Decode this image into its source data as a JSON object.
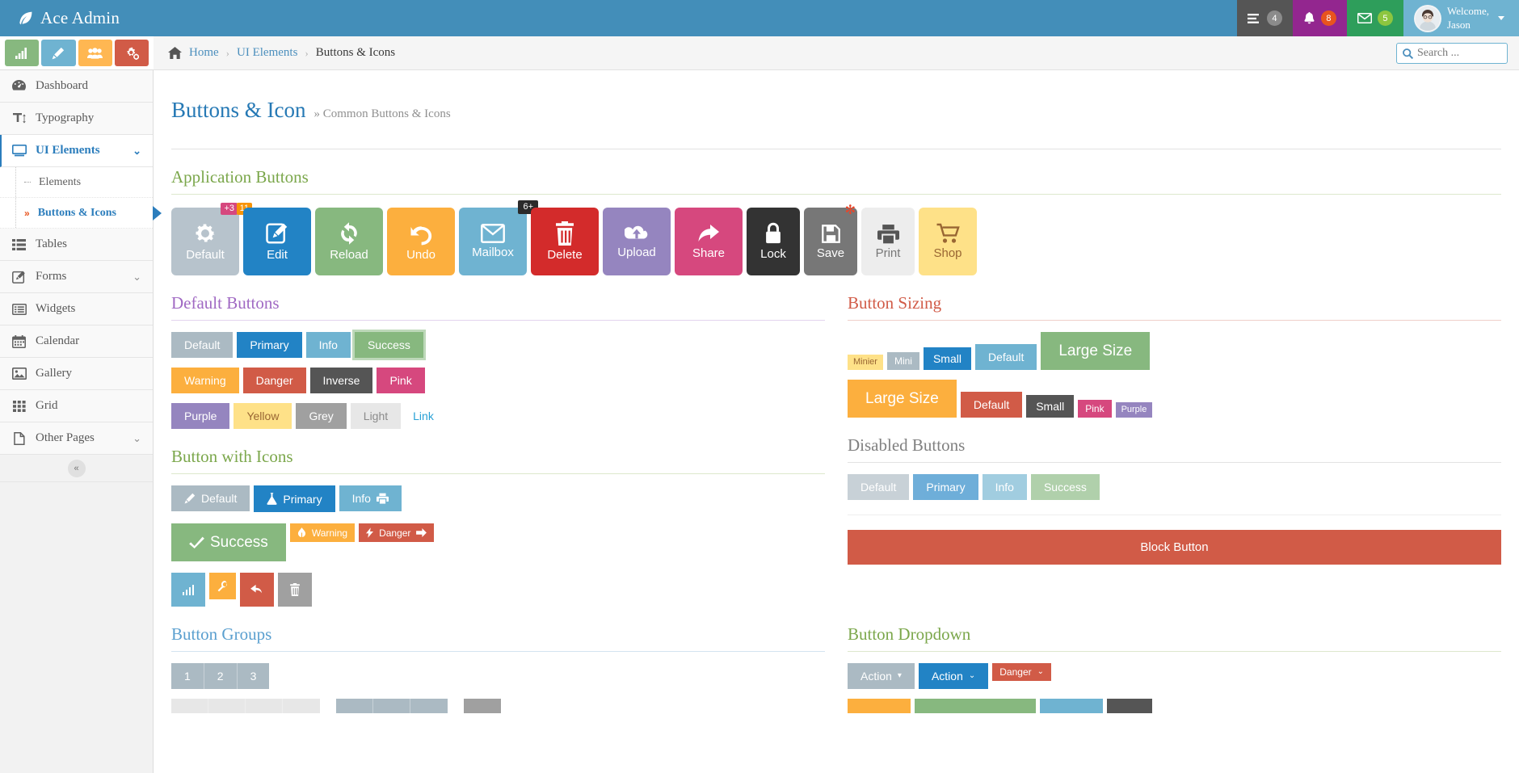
{
  "brand": {
    "title": "Ace Admin",
    "logo_icon": "leaf-icon"
  },
  "navbar": {
    "items": [
      {
        "name": "tasks",
        "icon": "tasks-icon",
        "badge": "4"
      },
      {
        "name": "notifications",
        "icon": "bell-icon",
        "badge": "8"
      },
      {
        "name": "messages",
        "icon": "envelope-icon",
        "badge": "5"
      }
    ],
    "user": {
      "welcome": "Welcome,",
      "name": "Jason"
    }
  },
  "shortcuts": [
    {
      "name": "chart",
      "icon": "bar-chart-icon",
      "color": "#87B87F"
    },
    {
      "name": "edit",
      "icon": "pencil-icon",
      "color": "#6FB3D1"
    },
    {
      "name": "users",
      "icon": "group-icon",
      "color": "#FFB752"
    },
    {
      "name": "settings",
      "icon": "cogs-icon",
      "color": "#D15B47"
    }
  ],
  "sidebar": {
    "items": [
      {
        "label": "Dashboard",
        "icon": "dashboard-icon",
        "chevron": false
      },
      {
        "label": "Typography",
        "icon": "text-height-icon",
        "chevron": false
      },
      {
        "label": "UI Elements",
        "icon": "desktop-icon",
        "chevron": true,
        "active": true
      },
      {
        "label": "Tables",
        "icon": "list-icon",
        "chevron": false
      },
      {
        "label": "Forms",
        "icon": "edit-icon",
        "chevron": true
      },
      {
        "label": "Widgets",
        "icon": "list-alt-icon",
        "chevron": false
      },
      {
        "label": "Calendar",
        "icon": "calendar-icon",
        "chevron": false
      },
      {
        "label": "Gallery",
        "icon": "picture-icon",
        "chevron": false
      },
      {
        "label": "Grid",
        "icon": "th-icon",
        "chevron": false
      },
      {
        "label": "Other Pages",
        "icon": "file-icon",
        "chevron": true
      }
    ],
    "submenu": [
      {
        "label": "Elements",
        "current": false
      },
      {
        "label": "Buttons & Icons",
        "current": true
      }
    ],
    "collapse_label": "«"
  },
  "breadcrumb": {
    "home": "Home",
    "items": [
      "UI Elements",
      "Buttons & Icons"
    ],
    "separator": "›"
  },
  "search": {
    "placeholder": "Search ...",
    "icon": "search-icon"
  },
  "page": {
    "title": "Buttons & Icon",
    "subtitle": "» Common Buttons & Icons"
  },
  "sections": {
    "application_buttons": {
      "heading": "Application Buttons",
      "buttons": [
        {
          "label": "Default",
          "icon": "gear-icon",
          "color": "#B7C3CC",
          "badges": [
            {
              "text": "+3",
              "style": "pink"
            },
            {
              "text": "11",
              "style": "orange"
            }
          ]
        },
        {
          "label": "Edit",
          "icon": "edit-square-icon",
          "color": "#2283C5",
          "badges": []
        },
        {
          "label": "Reload",
          "icon": "refresh-icon",
          "color": "#87B87F",
          "badges": []
        },
        {
          "label": "Undo",
          "icon": "undo-icon",
          "color": "#FCAF3E",
          "badges": []
        },
        {
          "label": "Mailbox",
          "icon": "envelope-icon",
          "color": "#6FB3D1",
          "badges": [
            {
              "text": "6+",
              "style": "dark"
            }
          ]
        },
        {
          "label": "Delete",
          "icon": "trash-icon",
          "color": "#D32B2B",
          "badges": []
        },
        {
          "label": "Upload",
          "icon": "cloud-upload-icon",
          "color": "#9585BF",
          "badges": []
        },
        {
          "label": "Share",
          "icon": "share-icon",
          "color": "#D6487E",
          "badges": []
        },
        {
          "label": "Lock",
          "icon": "lock-icon",
          "color": "#333333",
          "badges": []
        },
        {
          "label": "Save",
          "icon": "save-icon",
          "color": "#777777",
          "badges": [
            {
              "text": "✻",
              "style": "star"
            }
          ]
        },
        {
          "label": "Print",
          "icon": "print-icon",
          "color": "#EDEDED",
          "text_color": "#777777",
          "badges": []
        },
        {
          "label": "Shop",
          "icon": "cart-icon",
          "color": "#FEE188",
          "text_color": "#996633",
          "badges": []
        }
      ]
    },
    "default_buttons": {
      "heading": "Default Buttons",
      "row1": [
        {
          "label": "Default",
          "style": "default"
        },
        {
          "label": "Primary",
          "style": "primary"
        },
        {
          "label": "Info",
          "style": "info"
        },
        {
          "label": "Success",
          "style": "success",
          "focused": true
        }
      ],
      "row2": [
        {
          "label": "Warning",
          "style": "warning"
        },
        {
          "label": "Danger",
          "style": "danger"
        },
        {
          "label": "Inverse",
          "style": "inverse"
        },
        {
          "label": "Pink",
          "style": "pink"
        }
      ],
      "row3": [
        {
          "label": "Purple",
          "style": "purple"
        },
        {
          "label": "Yellow",
          "style": "yellow"
        },
        {
          "label": "Grey",
          "style": "grey"
        },
        {
          "label": "Light",
          "style": "light"
        },
        {
          "label": "Link",
          "style": "link"
        }
      ]
    },
    "button_sizing": {
      "heading": "Button Sizing",
      "row1": [
        {
          "label": "Minier",
          "style": "yellow",
          "size": "xmini"
        },
        {
          "label": "Mini",
          "style": "default",
          "size": "mini"
        },
        {
          "label": "Small",
          "style": "primary",
          "size": "small"
        },
        {
          "label": "Default",
          "style": "info",
          "size": ""
        },
        {
          "label": "Large Size",
          "style": "success",
          "size": "large"
        }
      ],
      "row2": [
        {
          "label": "Large Size",
          "style": "warning",
          "size": "large"
        },
        {
          "label": "Default",
          "style": "danger",
          "size": ""
        },
        {
          "label": "Small",
          "style": "inverse",
          "size": "small"
        },
        {
          "label": "Pink",
          "style": "pink",
          "size": "mini"
        },
        {
          "label": "Purple",
          "style": "purple",
          "size": "xmini"
        }
      ]
    },
    "disabled_buttons": {
      "heading": "Disabled Buttons",
      "buttons": [
        {
          "label": "Default",
          "style": "default"
        },
        {
          "label": "Primary",
          "style": "primary"
        },
        {
          "label": "Info",
          "style": "info"
        },
        {
          "label": "Success",
          "style": "success"
        }
      ],
      "block_button": {
        "label": "Block Button",
        "style": "danger"
      }
    },
    "button_with_icons": {
      "heading": "Button with Icons",
      "row1": [
        {
          "label": "Default",
          "style": "default",
          "icon": "pencil-icon",
          "icon_pos": "left"
        },
        {
          "label": "Primary",
          "style": "primary",
          "icon": "flask-icon",
          "icon_pos": "left"
        },
        {
          "label": "Info",
          "style": "info",
          "icon": "print-icon",
          "icon_pos": "right"
        }
      ],
      "row2": [
        {
          "label": "Success",
          "style": "success",
          "icon": "check-icon",
          "icon_pos": "left",
          "size": "large"
        },
        {
          "label": "Warning",
          "style": "warning",
          "icon": "leaf-icon",
          "icon_pos": "left",
          "size": "mini"
        },
        {
          "label": "Danger",
          "style": "danger",
          "icon": "bolt-icon",
          "icon_pos": "left",
          "icon2": "arrow-right-icon",
          "size": "mini"
        }
      ],
      "row3": [
        {
          "icon": "bar-chart-icon",
          "style": "info",
          "size": ""
        },
        {
          "icon": "wrench-icon",
          "style": "warning",
          "size": "sm"
        },
        {
          "icon": "undo-icon",
          "style": "danger",
          "size": ""
        },
        {
          "icon": "trash-icon",
          "style": "grey",
          "size": ""
        }
      ]
    },
    "button_groups": {
      "heading": "Button Groups",
      "group1": [
        "1",
        "2",
        "3"
      ],
      "group2": [
        "",
        "",
        "",
        ""
      ],
      "group3": [
        "",
        "",
        ""
      ],
      "group4": [
        ""
      ]
    },
    "button_dropdown": {
      "heading": "Button Dropdown",
      "buttons": [
        {
          "label": "Action",
          "style": "default",
          "caret": "▾"
        },
        {
          "label": "Action",
          "style": "primary",
          "caret": "⌄"
        },
        {
          "label": "Danger",
          "style": "danger",
          "caret": "⌄"
        }
      ],
      "row2": [
        {
          "label": "",
          "style": "warning"
        },
        {
          "label": "",
          "style": "success"
        },
        {
          "label": "",
          "style": "info"
        },
        {
          "label": "",
          "style": "inverse"
        }
      ]
    }
  },
  "colors": {
    "navbar": "#438EB9",
    "accent_blue": "#2B7DBC",
    "sidebar_bg": "#F2F2F2",
    "green": "#87B87F",
    "red": "#D15B47",
    "purple": "#A069C3"
  }
}
